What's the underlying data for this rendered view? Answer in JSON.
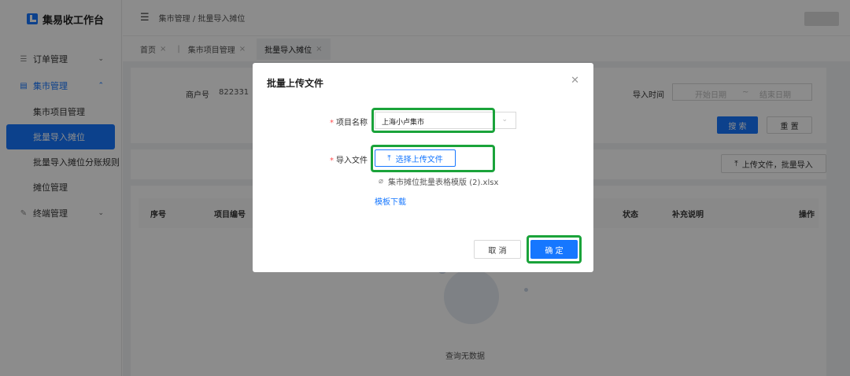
{
  "app": {
    "title": "集易收工作台"
  },
  "sidebar": {
    "groups": [
      {
        "label": "订单管理",
        "icon": "list-icon",
        "chevron": "⌄"
      },
      {
        "label": "集市管理",
        "icon": "grid-icon",
        "chevron": "⌃"
      },
      {
        "label": "终端管理",
        "icon": "wrench-icon",
        "chevron": "⌄"
      }
    ],
    "market_items": [
      "集市项目管理",
      "批量导入摊位",
      "批量导入摊位分账规则",
      "摊位管理"
    ]
  },
  "header": {
    "breadcrumb": "集市管理 / 批量导入摊位"
  },
  "tabs": [
    {
      "label": "首页"
    },
    {
      "label": "集市项目管理"
    },
    {
      "label": "批量导入摊位"
    }
  ],
  "filter": {
    "merchant_label": "商户号",
    "merchant_value": "822331",
    "import_time_label": "导入时间",
    "start_placeholder": "开始日期",
    "range_sep": "~",
    "end_placeholder": "结束日期",
    "search_button": "搜 索",
    "reset_button": "重 置"
  },
  "toolbar": {
    "upload_button": "上传文件，批量导入"
  },
  "table": {
    "columns": [
      "序号",
      "项目编号",
      "状态",
      "补充说明",
      "操作"
    ],
    "empty_text": "查询无数据"
  },
  "modal": {
    "title": "批量上传文件",
    "project_label": "项目名称",
    "project_value": "上海小卢集市",
    "file_label": "导入文件",
    "upload_button": "选择上传文件",
    "file_name": "集市摊位批量表格模版 (2).xlsx",
    "template_link": "模板下载",
    "cancel_button": "取 消",
    "ok_button": "确 定"
  },
  "colors": {
    "primary": "#1677ff",
    "highlight": "#1aa33a"
  }
}
